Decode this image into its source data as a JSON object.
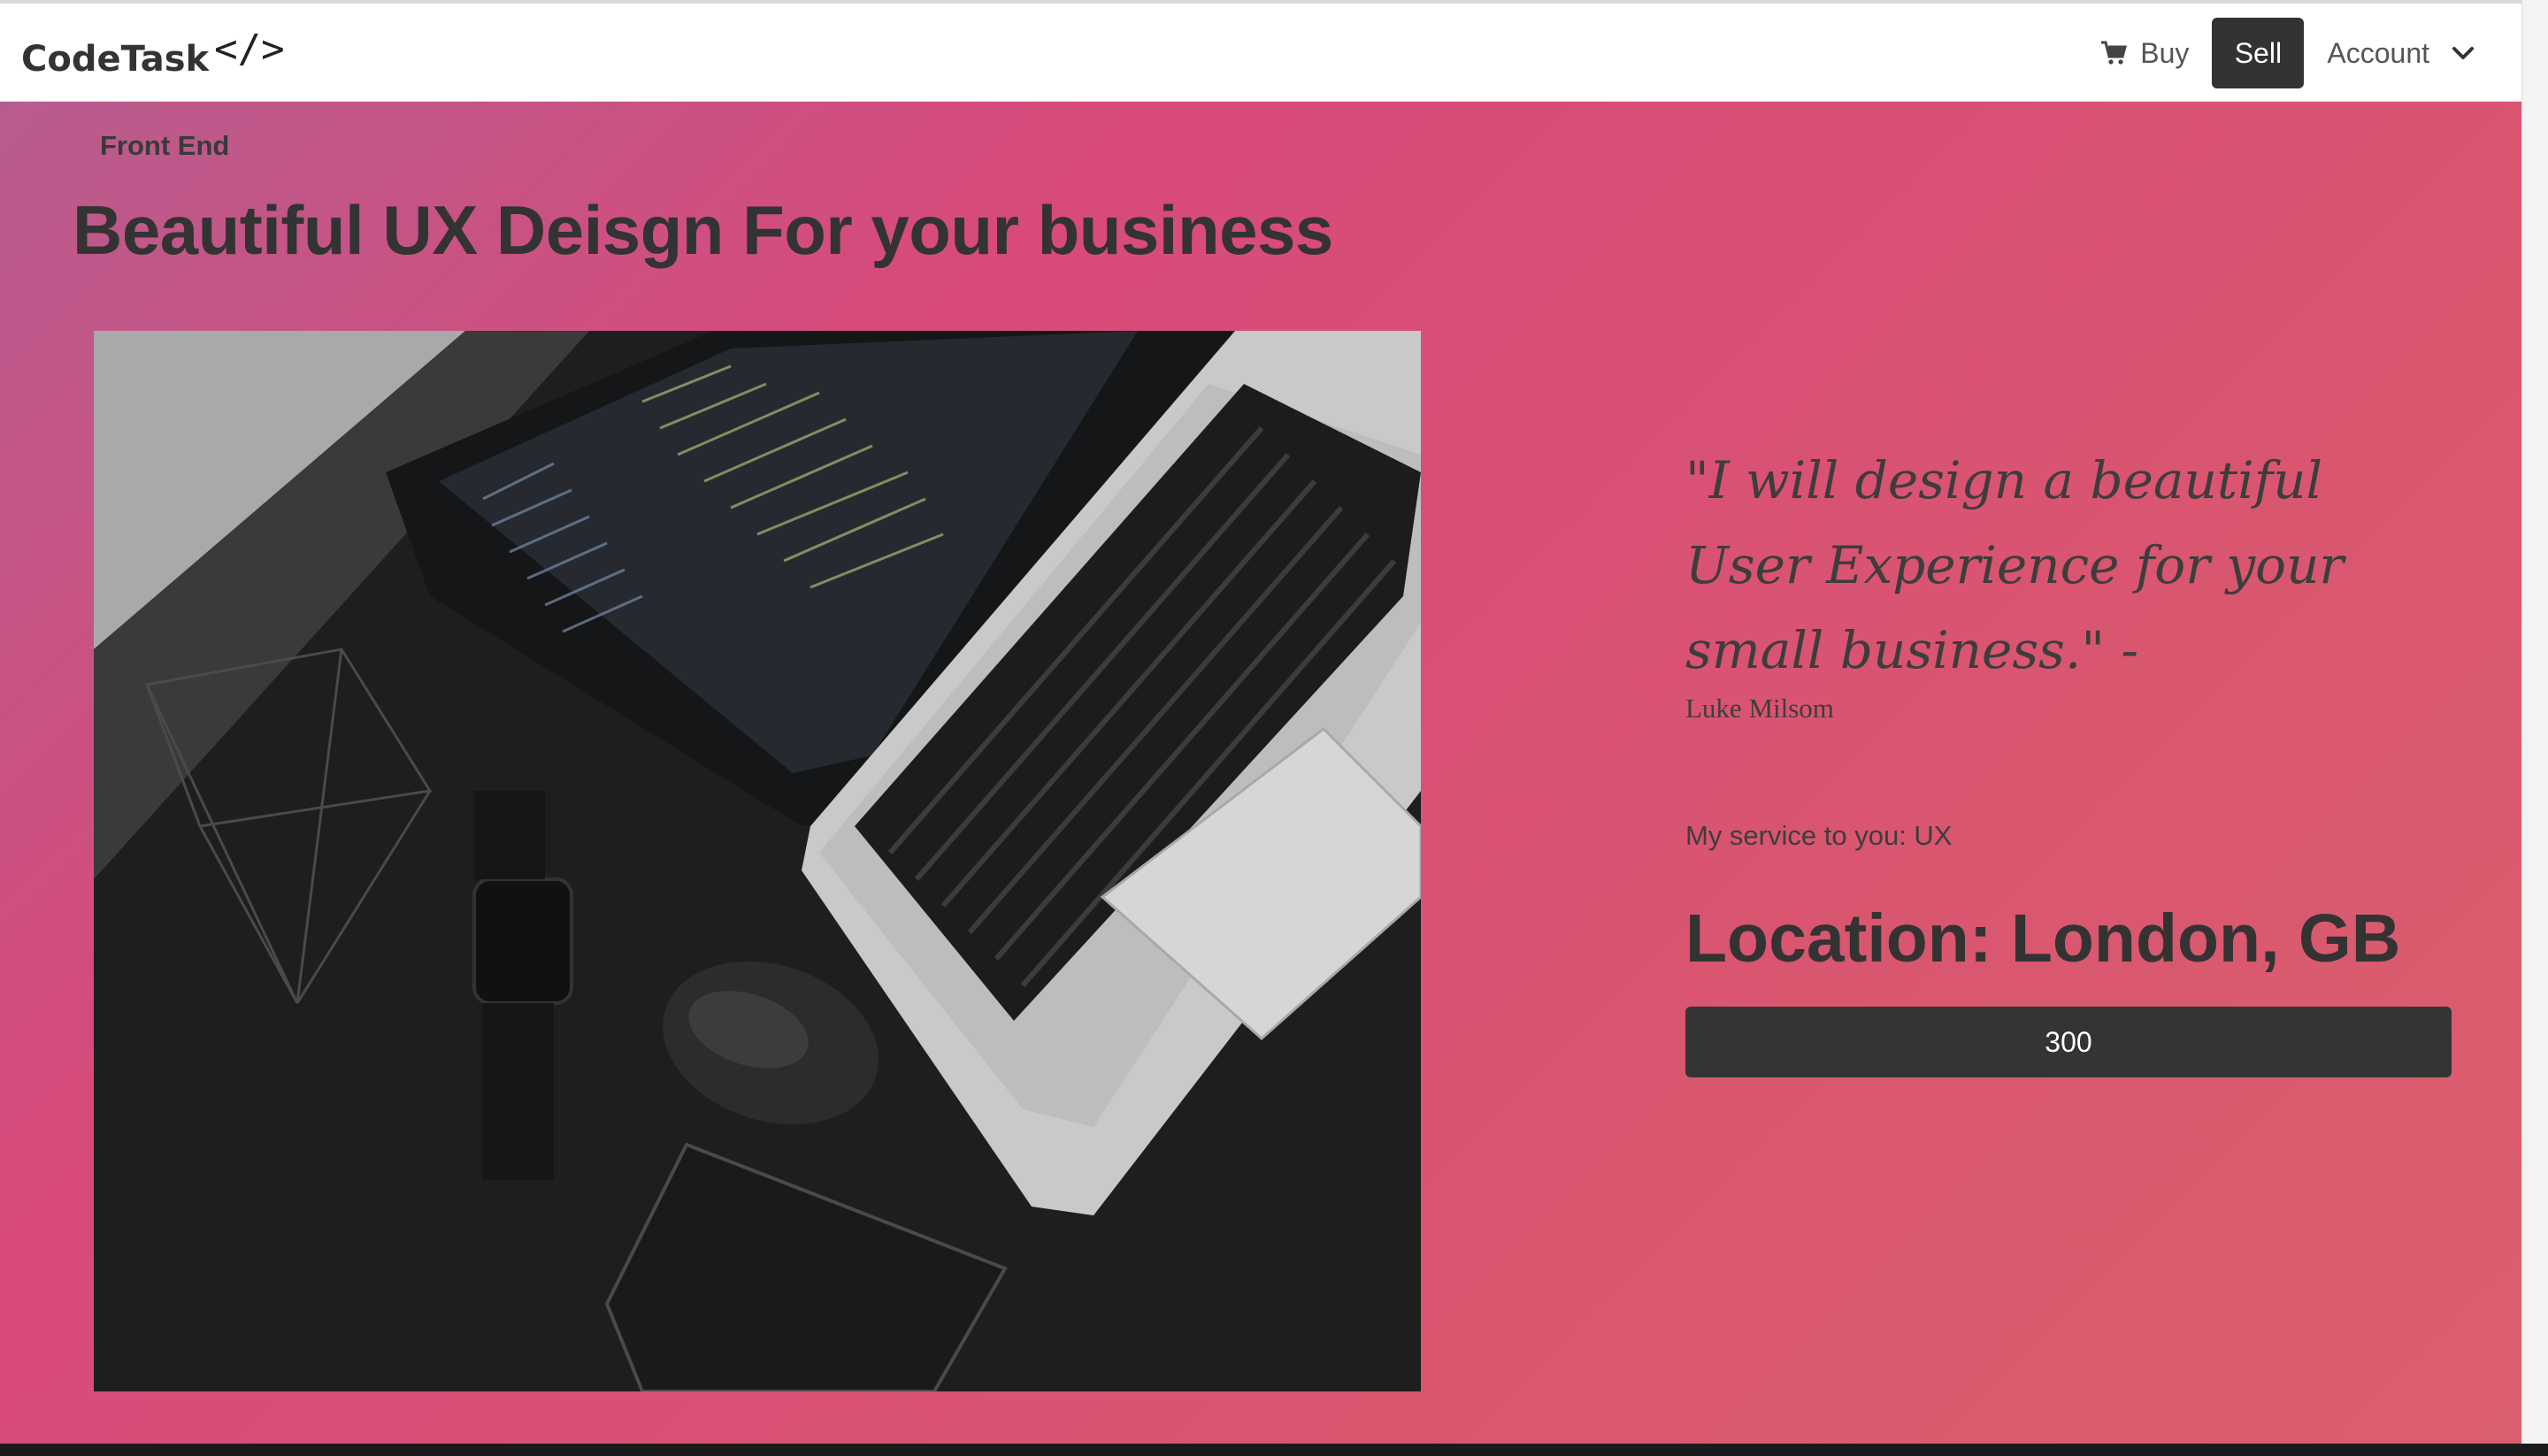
{
  "navbar": {
    "brand": "CodeTask",
    "brand_icon": "</>",
    "buy_label": "Buy",
    "sell_label": "Sell",
    "account_label": "Account"
  },
  "listing": {
    "category": "Front End",
    "title": "Beautiful UX Deisgn For your business",
    "quote": "\"I will design a beautiful User Experience for your small business.\" -",
    "author": "Luke Milsom",
    "service": "My service to you: UX",
    "location": "Location: London, GB",
    "price": "300"
  },
  "colors": {
    "gradient_start": "#b85c8e",
    "gradient_mid": "#d84a7b",
    "gradient_end": "#da5f6e",
    "dark_button": "#343434"
  },
  "icons": [
    "cart-icon",
    "chevron-down-icon",
    "code-icon"
  ]
}
